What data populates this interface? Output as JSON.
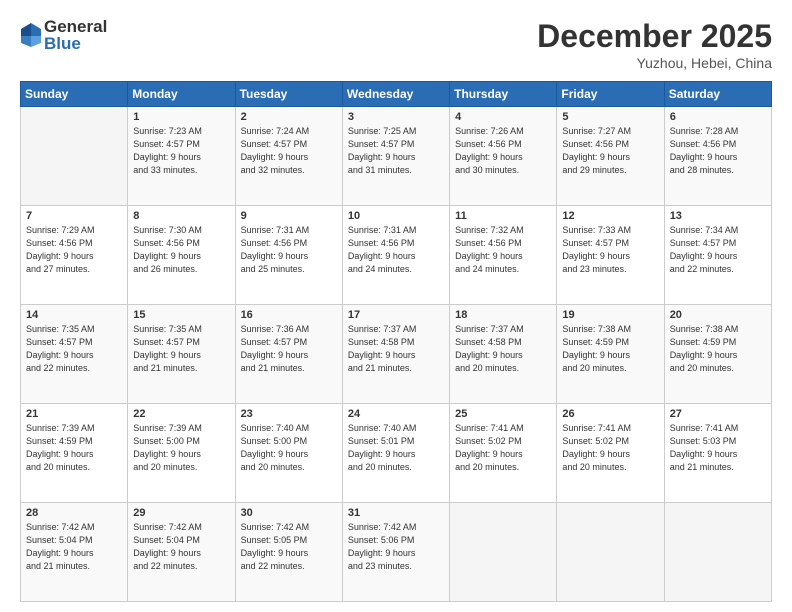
{
  "logo": {
    "general": "General",
    "blue": "Blue"
  },
  "header": {
    "month": "December 2025",
    "location": "Yuzhou, Hebei, China"
  },
  "weekdays": [
    "Sunday",
    "Monday",
    "Tuesday",
    "Wednesday",
    "Thursday",
    "Friday",
    "Saturday"
  ],
  "weeks": [
    [
      {
        "day": "",
        "info": ""
      },
      {
        "day": "1",
        "info": "Sunrise: 7:23 AM\nSunset: 4:57 PM\nDaylight: 9 hours\nand 33 minutes."
      },
      {
        "day": "2",
        "info": "Sunrise: 7:24 AM\nSunset: 4:57 PM\nDaylight: 9 hours\nand 32 minutes."
      },
      {
        "day": "3",
        "info": "Sunrise: 7:25 AM\nSunset: 4:57 PM\nDaylight: 9 hours\nand 31 minutes."
      },
      {
        "day": "4",
        "info": "Sunrise: 7:26 AM\nSunset: 4:56 PM\nDaylight: 9 hours\nand 30 minutes."
      },
      {
        "day": "5",
        "info": "Sunrise: 7:27 AM\nSunset: 4:56 PM\nDaylight: 9 hours\nand 29 minutes."
      },
      {
        "day": "6",
        "info": "Sunrise: 7:28 AM\nSunset: 4:56 PM\nDaylight: 9 hours\nand 28 minutes."
      }
    ],
    [
      {
        "day": "7",
        "info": "Sunrise: 7:29 AM\nSunset: 4:56 PM\nDaylight: 9 hours\nand 27 minutes."
      },
      {
        "day": "8",
        "info": "Sunrise: 7:30 AM\nSunset: 4:56 PM\nDaylight: 9 hours\nand 26 minutes."
      },
      {
        "day": "9",
        "info": "Sunrise: 7:31 AM\nSunset: 4:56 PM\nDaylight: 9 hours\nand 25 minutes."
      },
      {
        "day": "10",
        "info": "Sunrise: 7:31 AM\nSunset: 4:56 PM\nDaylight: 9 hours\nand 24 minutes."
      },
      {
        "day": "11",
        "info": "Sunrise: 7:32 AM\nSunset: 4:56 PM\nDaylight: 9 hours\nand 24 minutes."
      },
      {
        "day": "12",
        "info": "Sunrise: 7:33 AM\nSunset: 4:57 PM\nDaylight: 9 hours\nand 23 minutes."
      },
      {
        "day": "13",
        "info": "Sunrise: 7:34 AM\nSunset: 4:57 PM\nDaylight: 9 hours\nand 22 minutes."
      }
    ],
    [
      {
        "day": "14",
        "info": "Sunrise: 7:35 AM\nSunset: 4:57 PM\nDaylight: 9 hours\nand 22 minutes."
      },
      {
        "day": "15",
        "info": "Sunrise: 7:35 AM\nSunset: 4:57 PM\nDaylight: 9 hours\nand 21 minutes."
      },
      {
        "day": "16",
        "info": "Sunrise: 7:36 AM\nSunset: 4:57 PM\nDaylight: 9 hours\nand 21 minutes."
      },
      {
        "day": "17",
        "info": "Sunrise: 7:37 AM\nSunset: 4:58 PM\nDaylight: 9 hours\nand 21 minutes."
      },
      {
        "day": "18",
        "info": "Sunrise: 7:37 AM\nSunset: 4:58 PM\nDaylight: 9 hours\nand 20 minutes."
      },
      {
        "day": "19",
        "info": "Sunrise: 7:38 AM\nSunset: 4:59 PM\nDaylight: 9 hours\nand 20 minutes."
      },
      {
        "day": "20",
        "info": "Sunrise: 7:38 AM\nSunset: 4:59 PM\nDaylight: 9 hours\nand 20 minutes."
      }
    ],
    [
      {
        "day": "21",
        "info": "Sunrise: 7:39 AM\nSunset: 4:59 PM\nDaylight: 9 hours\nand 20 minutes."
      },
      {
        "day": "22",
        "info": "Sunrise: 7:39 AM\nSunset: 5:00 PM\nDaylight: 9 hours\nand 20 minutes."
      },
      {
        "day": "23",
        "info": "Sunrise: 7:40 AM\nSunset: 5:00 PM\nDaylight: 9 hours\nand 20 minutes."
      },
      {
        "day": "24",
        "info": "Sunrise: 7:40 AM\nSunset: 5:01 PM\nDaylight: 9 hours\nand 20 minutes."
      },
      {
        "day": "25",
        "info": "Sunrise: 7:41 AM\nSunset: 5:02 PM\nDaylight: 9 hours\nand 20 minutes."
      },
      {
        "day": "26",
        "info": "Sunrise: 7:41 AM\nSunset: 5:02 PM\nDaylight: 9 hours\nand 20 minutes."
      },
      {
        "day": "27",
        "info": "Sunrise: 7:41 AM\nSunset: 5:03 PM\nDaylight: 9 hours\nand 21 minutes."
      }
    ],
    [
      {
        "day": "28",
        "info": "Sunrise: 7:42 AM\nSunset: 5:04 PM\nDaylight: 9 hours\nand 21 minutes."
      },
      {
        "day": "29",
        "info": "Sunrise: 7:42 AM\nSunset: 5:04 PM\nDaylight: 9 hours\nand 22 minutes."
      },
      {
        "day": "30",
        "info": "Sunrise: 7:42 AM\nSunset: 5:05 PM\nDaylight: 9 hours\nand 22 minutes."
      },
      {
        "day": "31",
        "info": "Sunrise: 7:42 AM\nSunset: 5:06 PM\nDaylight: 9 hours\nand 23 minutes."
      },
      {
        "day": "",
        "info": ""
      },
      {
        "day": "",
        "info": ""
      },
      {
        "day": "",
        "info": ""
      }
    ]
  ]
}
